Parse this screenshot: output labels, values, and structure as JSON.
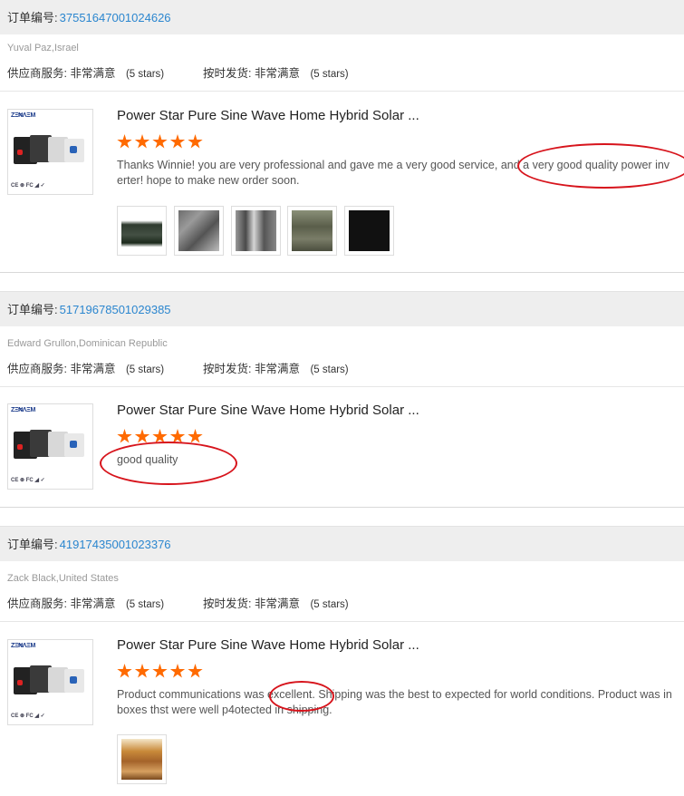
{
  "labels": {
    "order_no": "订单编号:",
    "supplier_service": "供应商服务:",
    "on_time_shipping": "按时发货:",
    "very_satisfied": "非常满意",
    "five_stars": "(5 stars)"
  },
  "colors": {
    "accent_link": "#2b86cf",
    "star": "#ff6a00",
    "highlight_oval": "#d7141c",
    "header_bg": "#eeeeee"
  },
  "orders": [
    {
      "order_number": "37551647001024626",
      "buyer": "Yuval Paz,Israel",
      "product_title": "Power Star Pure Sine Wave Home Hybrid Solar ...",
      "rating_stars": 5,
      "review": "Thanks Winnie! you are very professional and gave me a very good service, and a very good quality power inverter! hope to make new order soon.",
      "photos": [
        "review-photo-1",
        "review-photo-2",
        "review-photo-3",
        "review-photo-4",
        "review-photo-5"
      ]
    },
    {
      "order_number": "51719678501029385",
      "buyer": "Edward Grullon,Dominican Republic",
      "product_title": "Power Star Pure Sine Wave Home Hybrid Solar ...",
      "rating_stars": 5,
      "review": "good quality",
      "photos": []
    },
    {
      "order_number": "41917435001023376",
      "buyer": "Zack Black,United States",
      "product_title": "Power Star Pure Sine Wave Home Hybrid Solar ...",
      "rating_stars": 5,
      "review": "Product communications was excellent. Shipping was the best to expected for world conditions.  Product was in boxes thst were well p4otected in shipping.",
      "photos": [
        "review-photo-1"
      ]
    }
  ]
}
